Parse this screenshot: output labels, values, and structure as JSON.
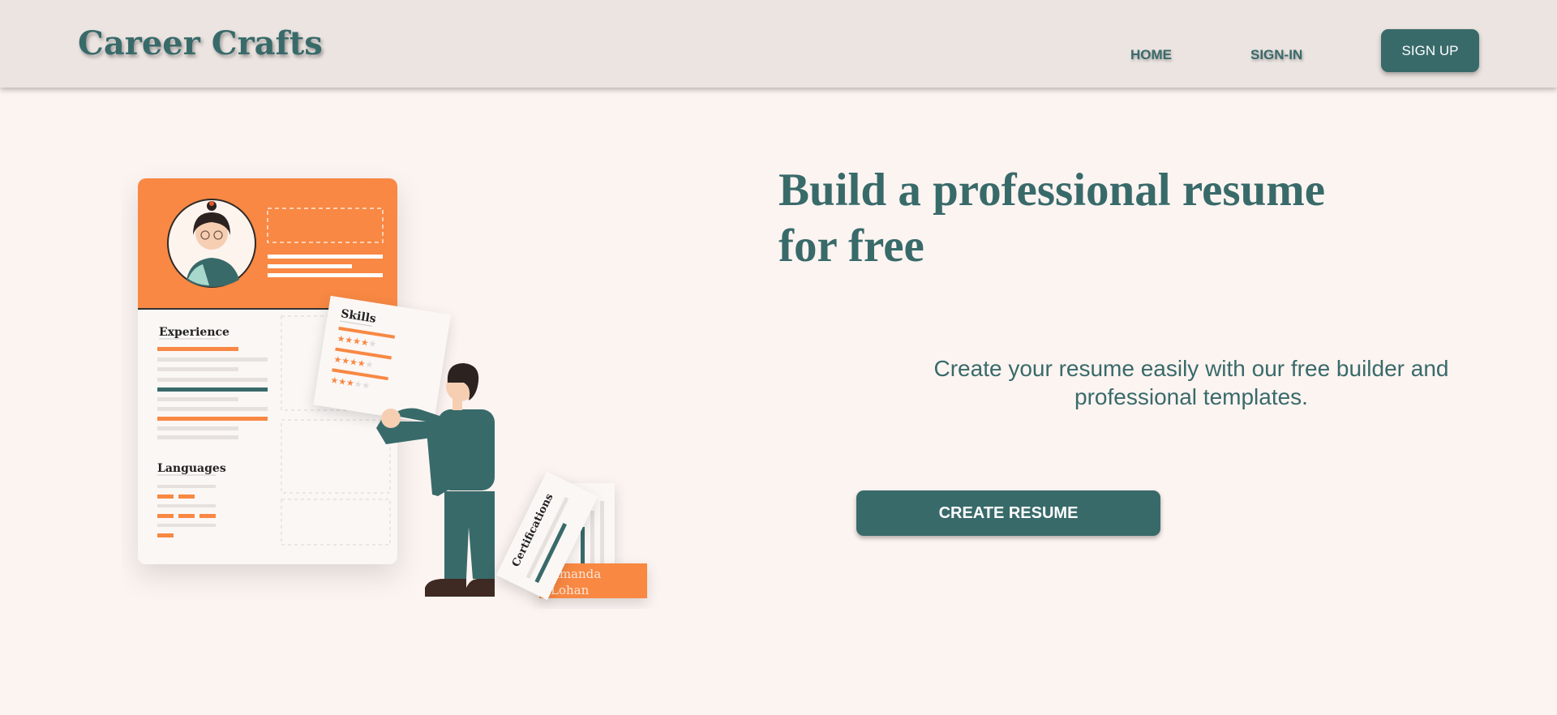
{
  "header": {
    "logo": "Career Crafts",
    "nav": {
      "home": "HOME",
      "signin": "SIGN-IN"
    },
    "signup_label": "SIGN UP"
  },
  "hero": {
    "title_line1": "Build a professional resume",
    "title_line2": "for free",
    "subtitle": "Create your resume easily with our free builder and professional templates.",
    "cta_label": "CREATE RESUME"
  },
  "illustration": {
    "experience_label": "Experience",
    "languages_label": "Languages",
    "skills_label": "Skills",
    "certifications_label": "Certifications",
    "name_line1": "Amanda",
    "name_line2": "Lohan"
  },
  "colors": {
    "accent": "#396a6a",
    "orange": "#f88843",
    "header_bg": "#ebe4e1",
    "page_bg": "#fcf4f1"
  }
}
